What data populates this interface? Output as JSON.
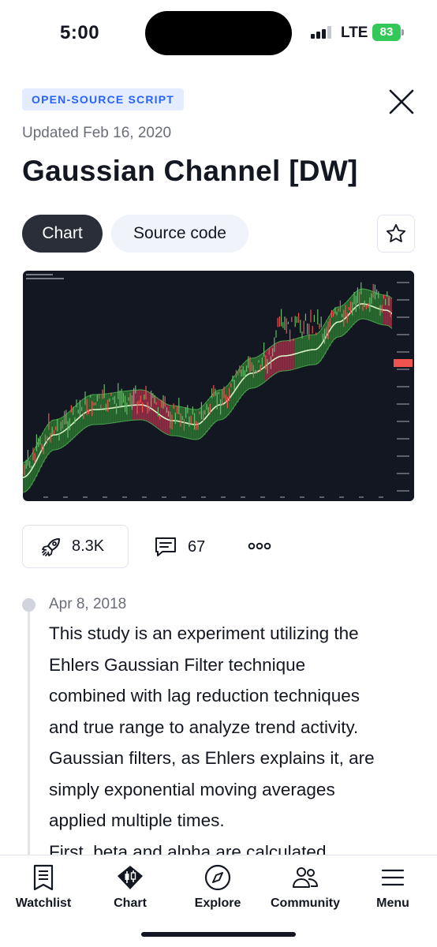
{
  "status_bar": {
    "time": "5:00",
    "network": "LTE",
    "battery": "83"
  },
  "header": {
    "badge": "OPEN-SOURCE SCRIPT",
    "updated": "Updated Feb 16, 2020",
    "title": "Gaussian Channel [DW]"
  },
  "tabs": [
    {
      "label": "Chart",
      "active": true
    },
    {
      "label": "Source code",
      "active": false
    }
  ],
  "actions": {
    "boosts": "8.3K",
    "comments": "67"
  },
  "description": {
    "date": "Apr 8, 2018",
    "lines": [
      "This study is an experiment utilizing the",
      "Ehlers Gaussian Filter technique",
      "combined with lag reduction techniques",
      "and true range to analyze trend activity.",
      "Gaussian filters, as Ehlers explains it, are",
      "simply exponential moving averages",
      "applied multiple times.",
      "First, beta and alpha are calculated"
    ]
  },
  "nav": [
    {
      "label": "Watchlist",
      "icon": "watchlist-icon"
    },
    {
      "label": "Chart",
      "icon": "chart-candles-icon"
    },
    {
      "label": "Explore",
      "icon": "compass-icon"
    },
    {
      "label": "Community",
      "icon": "people-icon"
    },
    {
      "label": "Menu",
      "icon": "hamburger-icon"
    }
  ],
  "colors": {
    "accent": "#2962ff",
    "chart_bg": "#131722",
    "up": "#26a69a",
    "down": "#ef5350",
    "channel_up": "#2e7d32",
    "channel_down": "#a8324a"
  }
}
